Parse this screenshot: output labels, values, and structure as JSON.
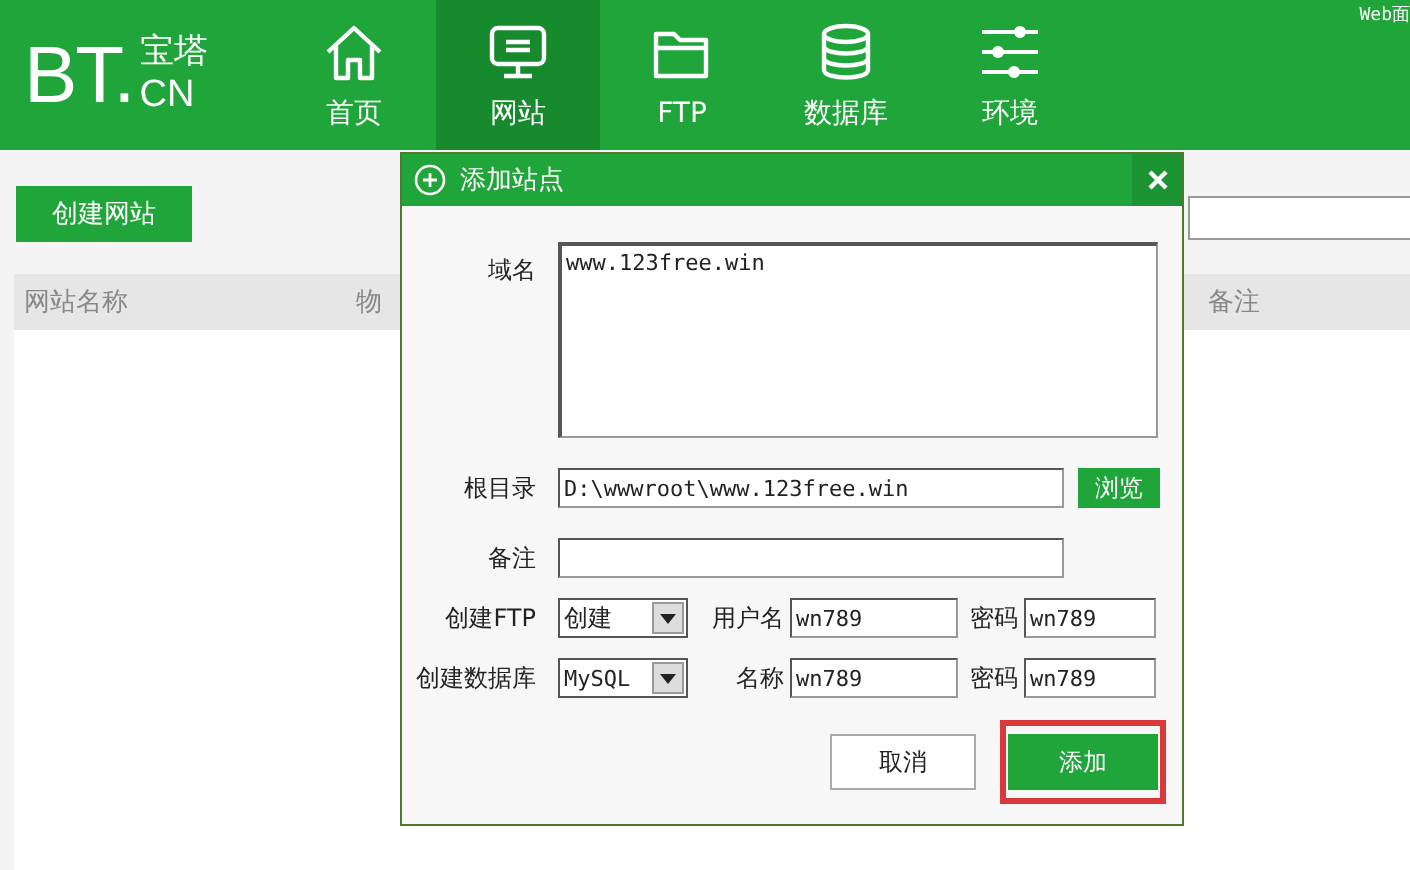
{
  "header": {
    "logo": {
      "mark": "BT.",
      "name": "宝塔",
      "domain": "CN"
    },
    "nav": [
      {
        "label": "首页",
        "selected": false
      },
      {
        "label": "网站",
        "selected": true
      },
      {
        "label": "FTP",
        "selected": false
      },
      {
        "label": "数据库",
        "selected": false
      },
      {
        "label": "环境",
        "selected": false
      }
    ],
    "corner_text": "Web面"
  },
  "toolbar": {
    "create_button": "创建网站"
  },
  "table": {
    "columns": [
      "网站名称",
      "物",
      "备注"
    ]
  },
  "dialog": {
    "title": "添加站点",
    "fields": [
      {
        "kind": "textarea",
        "label": "域名",
        "value": "www.123free.win"
      },
      {
        "kind": "input",
        "label": "根目录",
        "value": "D:\\wwwroot\\www.123free.win",
        "button": "浏览"
      },
      {
        "kind": "input",
        "label": "备注"
      }
    ],
    "option_rows": [
      {
        "label": "创建FTP",
        "select": "创建",
        "fields": [
          {
            "label": "用户名",
            "value": "wn789"
          },
          {
            "label": "密码",
            "value": "wn789"
          }
        ]
      },
      {
        "label": "创建数据库",
        "select": "MySQL",
        "fields": [
          {
            "label": "名称",
            "value": "wn789"
          },
          {
            "label": "密码",
            "value": "wn789"
          }
        ]
      }
    ],
    "buttons": [
      {
        "label": "取消",
        "kind": "secondary",
        "highlighted": false
      },
      {
        "label": "添加",
        "kind": "primary",
        "highlighted": true
      }
    ]
  }
}
